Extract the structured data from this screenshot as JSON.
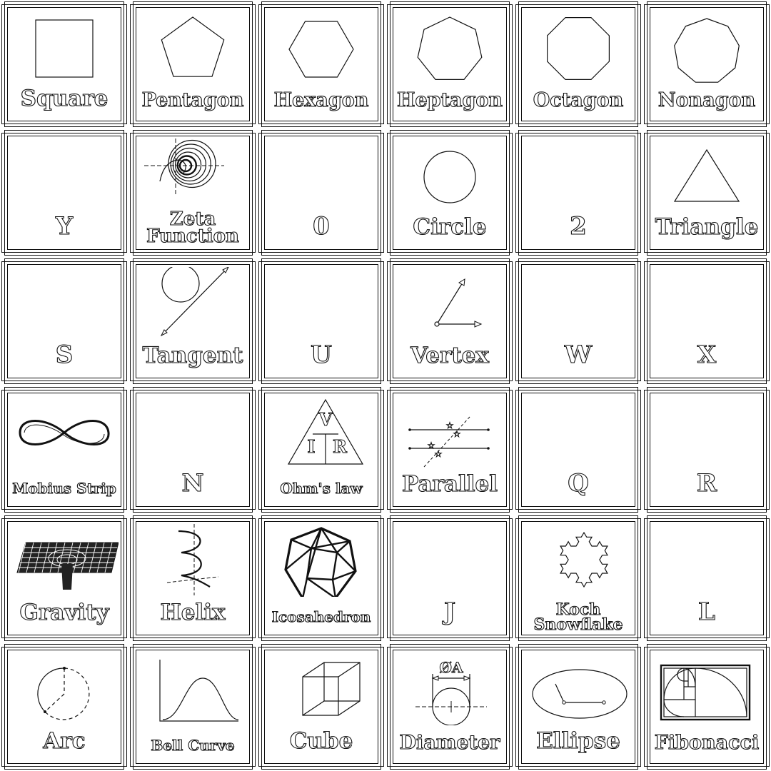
{
  "tiles": [
    {
      "label": "Square",
      "icon": "square-icon",
      "size": "big"
    },
    {
      "label": "Pentagon",
      "icon": "pentagon-icon",
      "size": "mid"
    },
    {
      "label": "Hexagon",
      "icon": "hexagon-icon",
      "size": "mid"
    },
    {
      "label": "Heptagon",
      "icon": "heptagon-icon",
      "size": "mid"
    },
    {
      "label": "Octagon",
      "icon": "octagon-icon",
      "size": "mid"
    },
    {
      "label": "Nonagon",
      "icon": "nonagon-icon",
      "size": "mid"
    },
    {
      "label": "Y",
      "icon": "",
      "size": "letter"
    },
    {
      "label": "Zeta\nFunction",
      "icon": "zeta-function-icon",
      "size": "two"
    },
    {
      "label": "0",
      "icon": "",
      "size": "letter"
    },
    {
      "label": "Circle",
      "icon": "circle-icon",
      "size": "big"
    },
    {
      "label": "2",
      "icon": "",
      "size": "letter"
    },
    {
      "label": "Triangle",
      "icon": "triangle-icon",
      "size": "big"
    },
    {
      "label": "S",
      "icon": "",
      "size": "letter"
    },
    {
      "label": "Tangent",
      "icon": "tangent-icon",
      "size": "big"
    },
    {
      "label": "U",
      "icon": "",
      "size": "letter"
    },
    {
      "label": "Vertex",
      "icon": "vertex-icon",
      "size": "big"
    },
    {
      "label": "W",
      "icon": "",
      "size": "letter"
    },
    {
      "label": "X",
      "icon": "",
      "size": "letter"
    },
    {
      "label": "Mobius Strip",
      "icon": "mobius-strip-icon",
      "size": "small"
    },
    {
      "label": "N",
      "icon": "",
      "size": "letter"
    },
    {
      "label": "Ohm's law",
      "icon": "ohms-law-icon",
      "size": "small",
      "tri": [
        "V",
        "I",
        "R"
      ]
    },
    {
      "label": "Parallel",
      "icon": "parallel-lines-icon",
      "size": "big"
    },
    {
      "label": "Q",
      "icon": "",
      "size": "letter"
    },
    {
      "label": "R",
      "icon": "",
      "size": "letter"
    },
    {
      "label": "Gravity",
      "icon": "gravity-well-icon",
      "size": "big"
    },
    {
      "label": "Helix",
      "icon": "helix-icon",
      "size": "big"
    },
    {
      "label": "Icosahedron",
      "icon": "icosahedron-icon",
      "size": "small"
    },
    {
      "label": "J",
      "icon": "",
      "size": "letter"
    },
    {
      "label": "Koch\nSnowflake",
      "icon": "koch-snowflake-icon",
      "size": "two-s"
    },
    {
      "label": "L",
      "icon": "",
      "size": "letter"
    },
    {
      "label": "Arc",
      "icon": "arc-icon",
      "size": "big"
    },
    {
      "label": "Bell Curve",
      "icon": "bell-curve-icon",
      "size": "small"
    },
    {
      "label": "Cube",
      "icon": "cube-icon",
      "size": "big"
    },
    {
      "label": "Diameter",
      "icon": "diameter-icon",
      "size": "mid",
      "dim": "ØA"
    },
    {
      "label": "Ellipse",
      "icon": "ellipse-icon",
      "size": "big"
    },
    {
      "label": "Fibonacci",
      "icon": "fibonacci-spiral-icon",
      "size": "mid"
    }
  ]
}
